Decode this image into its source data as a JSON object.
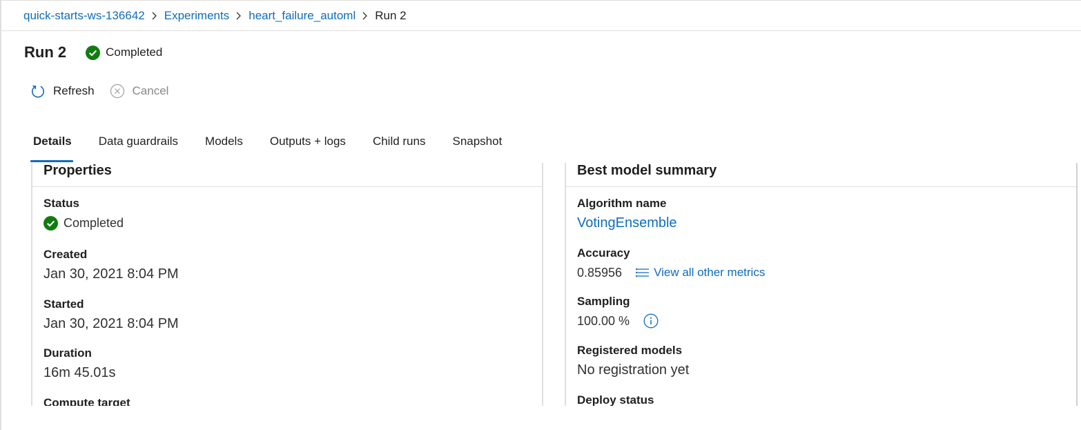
{
  "breadcrumb": {
    "workspace": "quick-starts-ws-136642",
    "experiments": "Experiments",
    "experiment": "heart_failure_automl",
    "current": "Run 2"
  },
  "header": {
    "title": "Run 2",
    "status": "Completed"
  },
  "toolbar": {
    "refresh": "Refresh",
    "cancel": "Cancel"
  },
  "tabs": [
    "Details",
    "Data guardrails",
    "Models",
    "Outputs + logs",
    "Child runs",
    "Snapshot"
  ],
  "properties": {
    "header": "Properties",
    "status_label": "Status",
    "status_value": "Completed",
    "created_label": "Created",
    "created_value": "Jan 30, 2021 8:04 PM",
    "started_label": "Started",
    "started_value": "Jan 30, 2021 8:04 PM",
    "duration_label": "Duration",
    "duration_value": "16m 45.01s",
    "compute_label": "Compute target"
  },
  "best_model": {
    "header": "Best model summary",
    "algorithm_label": "Algorithm name",
    "algorithm_value": "VotingEnsemble",
    "accuracy_label": "Accuracy",
    "accuracy_value": "0.85956",
    "metrics_link": "View all other metrics",
    "sampling_label": "Sampling",
    "sampling_value": "100.00 %",
    "registered_label": "Registered models",
    "registered_value": "No registration yet",
    "deploy_label": "Deploy status"
  },
  "colors": {
    "accent": "#0f6cbd",
    "success": "#107c10",
    "text": "#201f1e",
    "muted": "#8a8886"
  }
}
